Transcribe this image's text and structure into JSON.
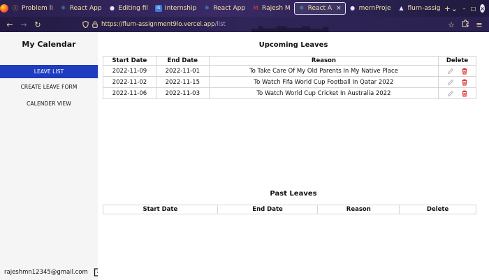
{
  "browser": {
    "tabs": [
      {
        "label": "Problem li",
        "icon": "info-icon",
        "color": "#f3c04a"
      },
      {
        "label": "React App",
        "icon": "react-icon",
        "color": "#61dafb"
      },
      {
        "label": "Editing fil",
        "icon": "github-icon",
        "color": "#e9e3ff"
      },
      {
        "label": "Internship",
        "icon": "is-badge-icon",
        "color": "#3a7bd5"
      },
      {
        "label": "React App",
        "icon": "react-icon",
        "color": "#61dafb"
      },
      {
        "label": "Rajesh M",
        "icon": "gmail-icon",
        "color": "#ea4335"
      },
      {
        "label": "React A",
        "icon": "react-icon",
        "color": "#61dafb",
        "active": true
      },
      {
        "label": "mernProje",
        "icon": "github-icon",
        "color": "#e9e3ff"
      },
      {
        "label": "flurn-assig",
        "icon": "vercel-icon",
        "color": "#e9e3ff"
      }
    ],
    "new_tab_label": "+",
    "url_host": "https://flurn-assignment9lo.vercel.app",
    "url_path": "/list"
  },
  "sidebar": {
    "title": "My Calendar",
    "items": [
      {
        "label": "LEAVE LIST",
        "active": true
      },
      {
        "label": "CREATE LEAVE FORM",
        "active": false
      },
      {
        "label": "CALENDER VIEW",
        "active": false
      }
    ],
    "user_email": "rajeshmn12345@gmail.com"
  },
  "upcoming": {
    "title": "Upcoming Leaves",
    "headers": [
      "Start Date",
      "End Date",
      "Reason",
      "Delete"
    ],
    "rows": [
      {
        "start": "2022-11-09",
        "end": "2022-11-01",
        "reason": "To Take Care Of My Old Parents In My Native Place"
      },
      {
        "start": "2022-11-02",
        "end": "2022-11-15",
        "reason": "To Watch Fifa World Cup Football In Qatar 2022"
      },
      {
        "start": "2022-11-06",
        "end": "2022-11-03",
        "reason": "To Watch World Cup Cricket In Australia 2022"
      }
    ]
  },
  "past": {
    "title": "Past Leaves",
    "headers": [
      "Start Date",
      "End Date",
      "Reason",
      "Delete"
    ]
  },
  "colors": {
    "accent": "#1f3bbf",
    "delete": "#e02424",
    "edit": "#b5b5b5"
  }
}
